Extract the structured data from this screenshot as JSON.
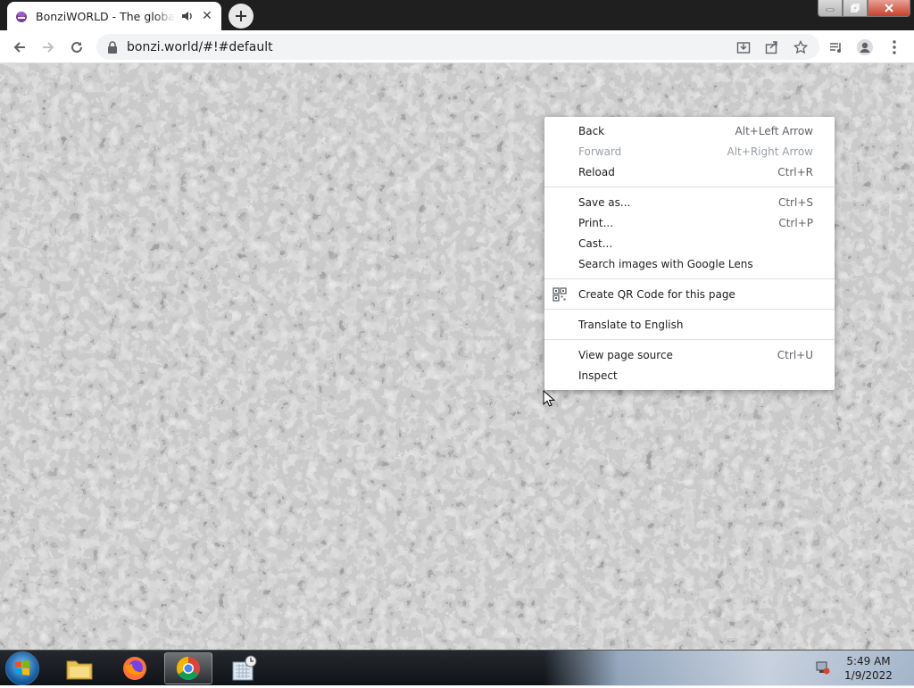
{
  "browser": {
    "tab_title": "BonziWORLD - The global leader in Bonzi",
    "url": "bonzi.world/#!#default"
  },
  "context_menu": {
    "items": [
      {
        "label": "Back",
        "shortcut": "Alt+Left Arrow",
        "enabled": true
      },
      {
        "label": "Forward",
        "shortcut": "Alt+Right Arrow",
        "enabled": false
      },
      {
        "label": "Reload",
        "shortcut": "Ctrl+R",
        "enabled": true
      },
      {
        "label": "Save as...",
        "shortcut": "Ctrl+S",
        "enabled": true
      },
      {
        "label": "Print...",
        "shortcut": "Ctrl+P",
        "enabled": true
      },
      {
        "label": "Cast...",
        "shortcut": "",
        "enabled": true
      },
      {
        "label": "Search images with Google Lens",
        "shortcut": "",
        "enabled": true
      },
      {
        "label": "Create QR Code for this page",
        "shortcut": "",
        "enabled": true
      },
      {
        "label": "Translate to English",
        "shortcut": "",
        "enabled": true
      },
      {
        "label": "View page source",
        "shortcut": "Ctrl+U",
        "enabled": true
      },
      {
        "label": "Inspect",
        "shortcut": "",
        "enabled": true
      }
    ]
  },
  "taskbar": {
    "time": "5:49 AM",
    "date": "1/9/2022",
    "apps": [
      "file-explorer-icon",
      "firefox-icon",
      "chrome-icon",
      "desktop-gadget-icon"
    ]
  },
  "colors": {
    "titlebar": "#1f1f1f",
    "menu_text": "#202124",
    "menu_disabled": "#9aa0a6"
  }
}
